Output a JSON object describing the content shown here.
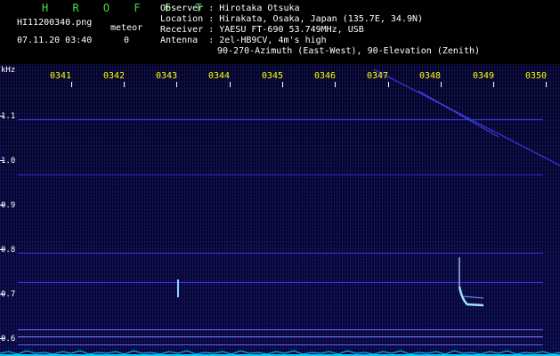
{
  "header": {
    "brand": "H R O F F T",
    "filename": "HI11200340.png",
    "category_label": "meteor",
    "datetime": "07.11.20 03:40",
    "count": "0",
    "observer_label": "Observer",
    "observer": "Hirotaka Otsuka",
    "location_label": "Location",
    "location": "Hirakata, Osaka, Japan (135.7E, 34.9N)",
    "receiver_label": "Receiver",
    "receiver": "YAESU FT-690 53.749MHz, USB",
    "antenna_label": "Antenna",
    "antenna": "2el-HB9CV, 4m's high",
    "antenna_line2": "90-270-Azimuth (East-West), 90-Elevation (Zenith)"
  },
  "axis": {
    "y_unit": "kHz",
    "y_labels": [
      "1.1",
      "1.0",
      "0.9",
      "0.8",
      "0.7",
      "0.6"
    ],
    "time_labels": [
      "0341",
      "0342",
      "0343",
      "0344",
      "0345",
      "0346",
      "0347",
      "0348",
      "0349",
      "0350"
    ]
  },
  "colors": {
    "text": "#ffffff",
    "brand": "#3fe03f",
    "time": "#ffff00",
    "signal": "#4040ff",
    "noise": "#00e0ff"
  }
}
